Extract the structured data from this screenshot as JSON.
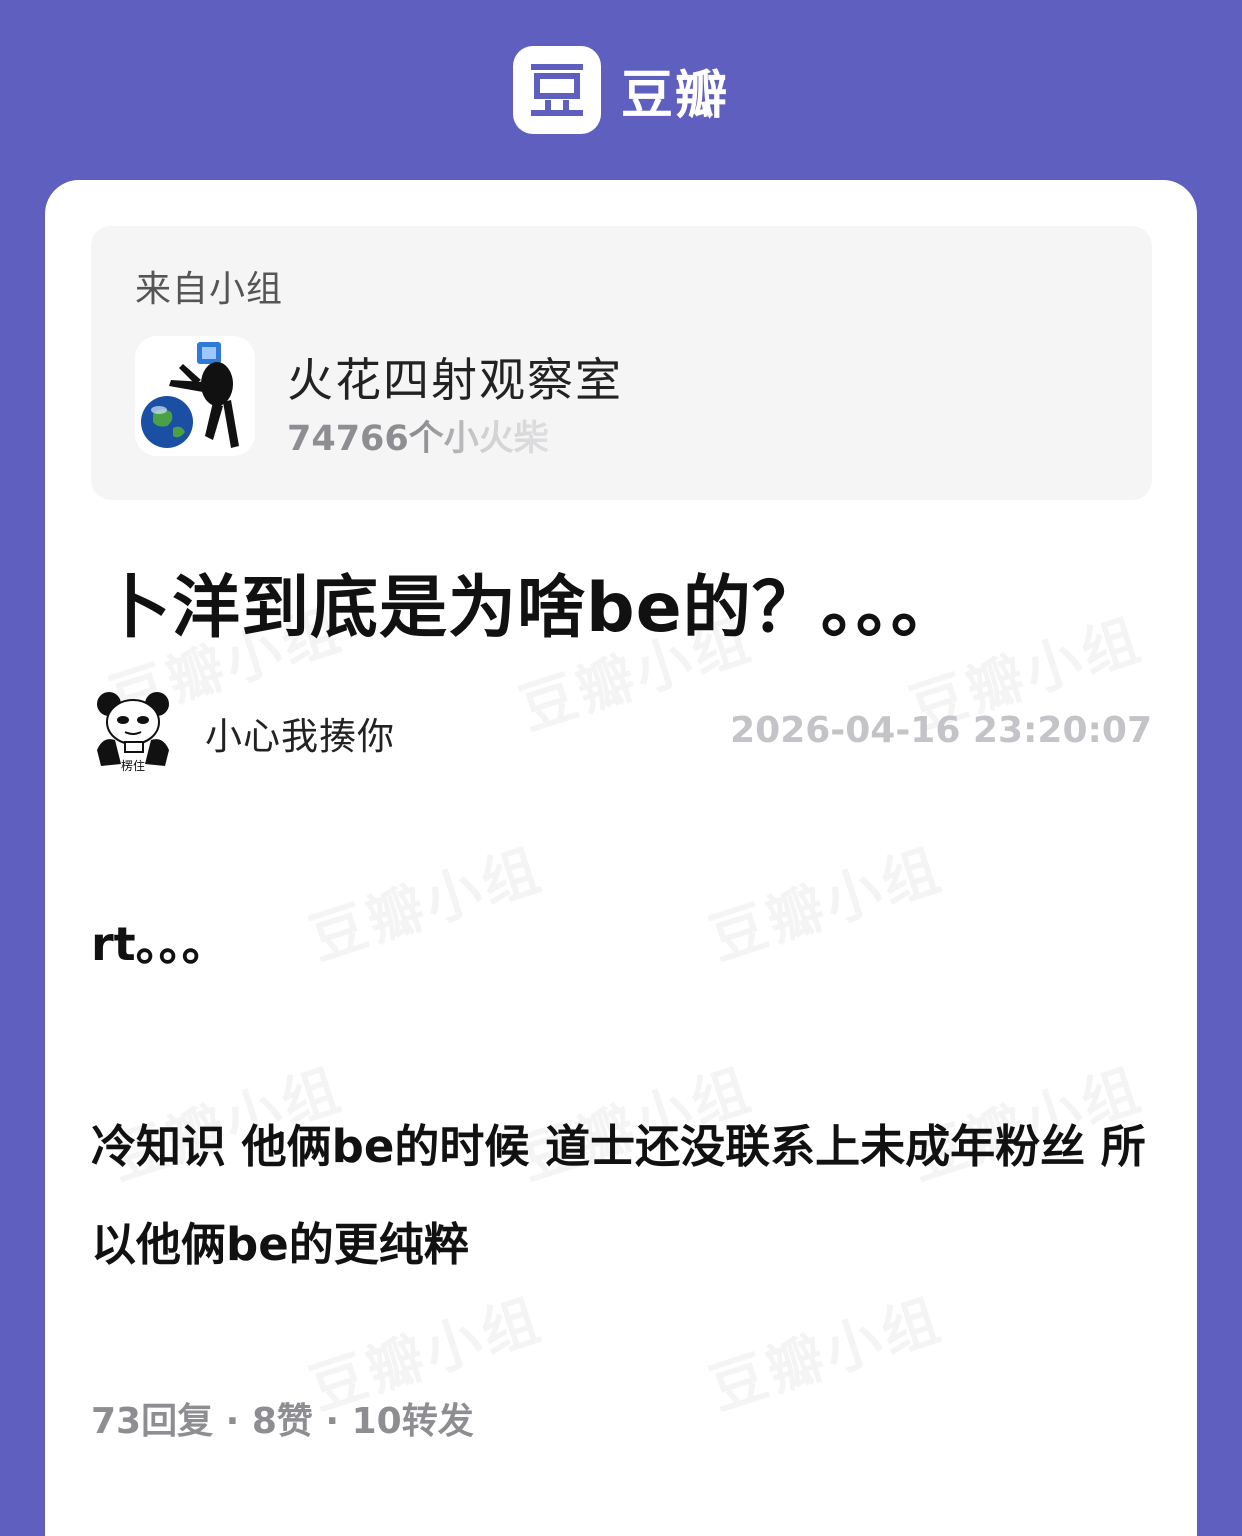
{
  "header": {
    "logo_glyph": "豆",
    "brand_name": "豆瓣"
  },
  "group": {
    "from_label": "来自小组",
    "name": "火花四射观察室",
    "members": "74766个小火柴"
  },
  "post": {
    "title": "卜洋到底是为啥be的？。。。",
    "author": "小心我揍你",
    "author_avatar_caption": "楞住",
    "time": "2026-04-16 23:20:07",
    "body_p1": "rt。。。",
    "body_p2": "冷知识 他俩be的时候 道士还没联系上未成年粉丝 所以他俩be的更纯粹",
    "stats": "73回复 · 8赞 · 10转发"
  },
  "watermark_text": "豆瓣小组",
  "colors": {
    "background": "#5e5fbf",
    "card": "#ffffff",
    "group_box": "#f5f5f6"
  }
}
